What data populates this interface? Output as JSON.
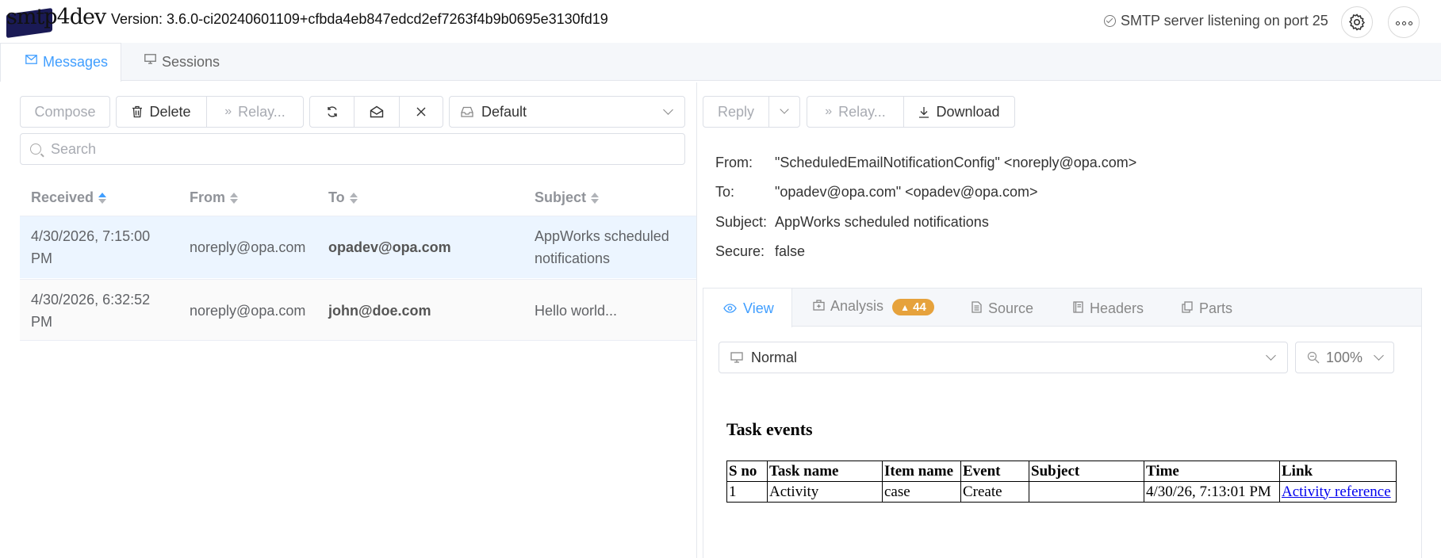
{
  "header": {
    "logo_text": "smtp4dev",
    "version": "Version: 3.6.0-ci20240601109+cfbda4eb847edcd2ef7263f4b9b0695e3130fd19",
    "status": "SMTP server listening on port 25"
  },
  "main_tabs": [
    {
      "label": "Messages",
      "icon": "envelope-icon",
      "active": true
    },
    {
      "label": "Sessions",
      "icon": "monitor-icon",
      "active": false
    }
  ],
  "toolbar": {
    "compose": "Compose",
    "delete": "Delete",
    "relay": "Relay...",
    "mailbox": "Default"
  },
  "search": {
    "placeholder": "Search"
  },
  "table": {
    "columns": [
      "Received",
      "From",
      "To",
      "Subject"
    ],
    "rows": [
      {
        "received_1": "4/30/2026, 7:15:00",
        "received_2": "PM",
        "from": "noreply@opa.com",
        "to": "opadev@opa.com",
        "subject_1": "AppWorks scheduled",
        "subject_2": "notifications"
      },
      {
        "received_1": "4/30/2026, 6:32:52",
        "received_2": "PM",
        "from": "noreply@opa.com",
        "to": "john@doe.com",
        "subject_1": "Hello world...",
        "subject_2": ""
      }
    ]
  },
  "detail_toolbar": {
    "reply": "Reply",
    "relay": "Relay...",
    "download": "Download"
  },
  "detail": {
    "from_label": "From:",
    "from": "\"ScheduledEmailNotificationConfig\" <noreply@opa.com>",
    "to_label": "To:",
    "to": "\"opadev@opa.com\" <opadev@opa.com>",
    "subject_label": "Subject:",
    "subject": "AppWorks scheduled notifications",
    "secure_label": "Secure:",
    "secure": "false"
  },
  "view_tabs": {
    "view": "View",
    "analysis": "Analysis",
    "analysis_count": "44",
    "source": "Source",
    "headers": "Headers",
    "parts": "Parts"
  },
  "view_options": {
    "mode": "Normal",
    "zoom": "100%"
  },
  "email_body": {
    "heading": "Task events",
    "columns": [
      "S no",
      "Task name",
      "Item name",
      "Event",
      "Subject",
      "Time",
      "Link"
    ],
    "row": {
      "sno": "1",
      "task": "Activity",
      "item": "case",
      "event": "Create",
      "subject": "",
      "time": "4/30/26, 7:13:01 PM",
      "link": "Activity reference"
    }
  },
  "colors": {
    "accent": "#409eff",
    "badge": "#e6a23c",
    "selected_row": "#ecf5ff"
  }
}
